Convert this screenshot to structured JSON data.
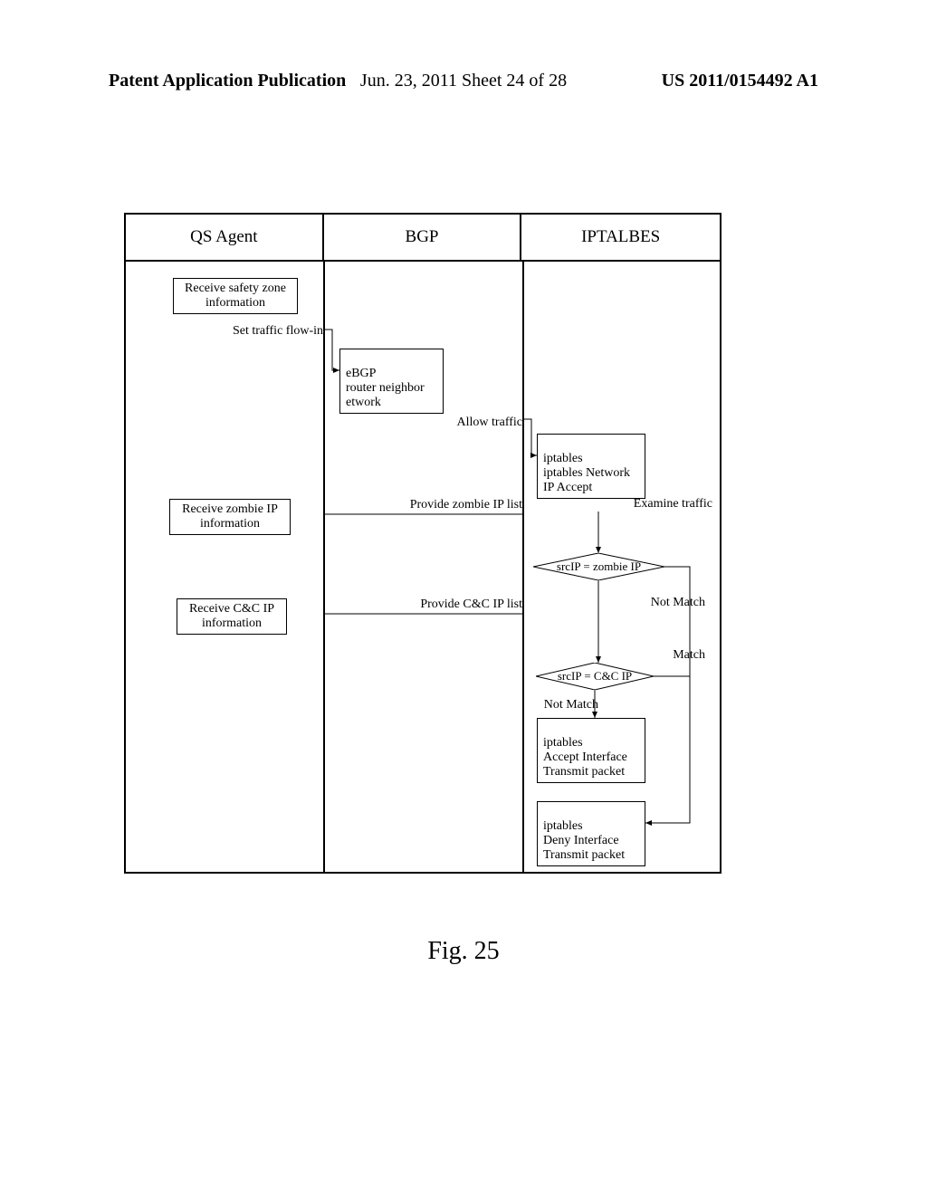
{
  "header": {
    "left": "Patent Application Publication",
    "center": "Jun. 23, 2011  Sheet 24 of 28",
    "right": "US 2011/0154492 A1"
  },
  "columns": {
    "col1": "QS Agent",
    "col2": "BGP",
    "col3": "IPTALBES"
  },
  "boxes": {
    "receive_safety": "Receive safety zone information",
    "ebgp": "eBGP\nrouter neighbor\network",
    "receive_zombie": "Receive zombie IP information",
    "receive_cc": "Receive C&C IP information",
    "iptables_accept_net": "iptables\niptables Network\nIP Accept",
    "iptables_accept_if": "iptables\nAccept Interface\nTransmit packet",
    "iptables_deny_if": "iptables\nDeny Interface\nTransmit packet"
  },
  "labels": {
    "set_traffic": "Set traffic flow-in",
    "allow_traffic": "Allow traffic",
    "provide_zombie": "Provide zombie IP list",
    "provide_cc": "Provide C&C IP list",
    "examine_traffic": "Examine traffic",
    "not_match1": "Not Match",
    "not_match2": "Not Match",
    "match": "Match"
  },
  "decisions": {
    "zombie": "srcIP = zombie IP",
    "cc": "srcIP = C&C IP"
  },
  "figure": "Fig. 25"
}
